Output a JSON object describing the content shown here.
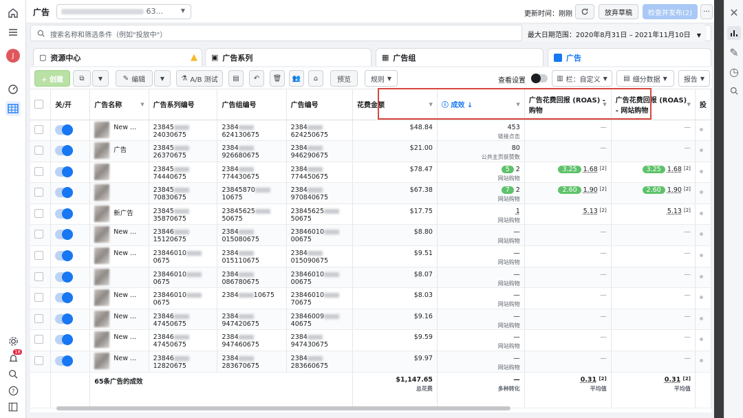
{
  "topbar": {
    "title": "广告",
    "account_fragment": "63...",
    "updated_label": "更新时间：刚刚",
    "discard_label": "放弃草稿",
    "publish_label": "检查并发布(2)",
    "more_label": "···"
  },
  "search": {
    "placeholder": "搜索名称和筛选条件（例如\"投放中\"）",
    "date_range": "最大日期范围：2020年8月31日 – 2021年11月10日"
  },
  "tabs": [
    {
      "label": "资源中心"
    },
    {
      "label": "广告系列"
    },
    {
      "label": "广告组"
    },
    {
      "label": "广告"
    }
  ],
  "toolbar": {
    "create": "+ 创建",
    "edit": "编辑",
    "ab_test": "A/B 测试",
    "preview": "预览",
    "rules": "规则",
    "view_settings": "查看设置",
    "columns": "栏：自定义",
    "breakdown": "细分数据",
    "reports": "报告"
  },
  "columns": {
    "onoff": "关/开",
    "name": "广告名称",
    "campaign_id": "广告系列编号",
    "adset_id": "广告组编号",
    "ad_id": "广告编号",
    "spend": "花费金额",
    "results": "成效",
    "roas": "广告花费回报 (ROAS) - 购物",
    "roas_web": "广告花费回报 (ROAS) - 网站购物",
    "bid": "投"
  },
  "rows": [
    {
      "name": "New ...",
      "campaign": "23845",
      "campaign_end": "24030675",
      "adset": "2384",
      "adset_end": "624130675",
      "ad": "2384",
      "ad_end": "624250675",
      "spend": "$48.84",
      "result": "453",
      "result_label": "链接点击",
      "pill": "",
      "roas": "—",
      "roas_web": "—"
    },
    {
      "name": "广告",
      "campaign": "23845",
      "campaign_end": "26370675",
      "adset": "2384",
      "adset_end": "926680675",
      "ad": "2384",
      "ad_end": "946290675",
      "spend": "$21.00",
      "result": "80",
      "result_label": "公共主页获赞数",
      "pill": "",
      "roas": "—",
      "roas_web": "—"
    },
    {
      "name": "",
      "campaign": "23845",
      "campaign_end": "74440675",
      "adset": "2384",
      "adset_end": "774430675",
      "ad": "2384",
      "ad_end": "774450675",
      "spend": "$78.47",
      "result": "2",
      "result_label": "网站购物",
      "pill": "5",
      "roas_pill": "3.25",
      "roas": "1.68",
      "roas_web_pill": "3.25",
      "roas_web": "1.68"
    },
    {
      "name": "",
      "campaign": "23845",
      "campaign_end": "70830675",
      "adset": "23845870",
      "adset_end": "10675",
      "ad": "2384",
      "ad_end": "970840675",
      "spend": "$67.38",
      "result": "2",
      "result_label": "网站购物",
      "pill": "7",
      "roas_pill": "2.60",
      "roas": "1.90",
      "roas_web_pill": "2.60",
      "roas_web": "1.90"
    },
    {
      "name": "新广告",
      "campaign": "23845",
      "campaign_end": "35870675",
      "adset": "23845625",
      "adset_end": "50675",
      "ad": "23845625",
      "ad_end": "50675",
      "spend": "$17.75",
      "result": "1",
      "result_label": "网站购物",
      "pill": "",
      "roas": "5.13",
      "roas_web": "5.13"
    },
    {
      "name": "New ...",
      "campaign": "23846",
      "campaign_end": "15120675",
      "adset": "2384",
      "adset_end": "015080675",
      "ad": "23846010",
      "ad_end": "00675",
      "spend": "$8.80",
      "result": "—",
      "result_label": "网站购物",
      "pill": "",
      "roas": "—",
      "roas_web": "—"
    },
    {
      "name": "New ...",
      "campaign": "23846010",
      "campaign_end": "0675",
      "adset": "2384",
      "adset_end": "015110675",
      "ad": "2384",
      "ad_end": "015090675",
      "spend": "$9.51",
      "result": "—",
      "result_label": "网站购物",
      "pill": "",
      "roas": "—",
      "roas_web": "—"
    },
    {
      "name": "",
      "campaign": "23846010",
      "campaign_end": "0675",
      "adset": "2384",
      "adset_end": "086780675",
      "ad": "23846010",
      "ad_end": "00675",
      "spend": "$8.07",
      "result": "—",
      "result_label": "网站购物",
      "pill": "",
      "roas": "—",
      "roas_web": "—"
    },
    {
      "name": "New ...",
      "campaign": "23846010",
      "campaign_end": "0675",
      "adset": "2384",
      "adset_end": "10675",
      "ad": "23846010",
      "ad_end": "70675",
      "spend": "$8.03",
      "result": "—",
      "result_label": "网站购物",
      "pill": "",
      "roas": "—",
      "roas_web": "—"
    },
    {
      "name": "New ...",
      "campaign": "23846",
      "campaign_end": "47450675",
      "adset": "2384",
      "adset_end": "947420675",
      "ad": "23846009",
      "ad_end": "40675",
      "spend": "$9.16",
      "result": "—",
      "result_label": "网站购物",
      "pill": "",
      "roas": "—",
      "roas_web": "—"
    },
    {
      "name": "New ...",
      "campaign": "23846",
      "campaign_end": "47450675",
      "adset": "2384",
      "adset_end": "947460675",
      "ad": "2384",
      "ad_end": "947430675",
      "spend": "$9.59",
      "result": "—",
      "result_label": "网站购物",
      "pill": "",
      "roas": "—",
      "roas_web": "—"
    },
    {
      "name": "New ...",
      "campaign": "23846",
      "campaign_end": "12820675",
      "adset": "2384",
      "adset_end": "283670675",
      "ad": "2384",
      "ad_end": "283660675",
      "spend": "$9.97",
      "result": "—",
      "result_label": "网站购物",
      "pill": "",
      "roas": "—",
      "roas_web": "—"
    }
  ],
  "footer": {
    "label": "65条广告的成效",
    "spend": "$1,147.65",
    "spend_label": "总花费",
    "result": "—",
    "result_label": "多种转化",
    "roas": "0.31",
    "roas_label": "平均值",
    "roas_web": "0.31",
    "roas_web_label": "平均值",
    "sup": "[2]"
  },
  "sidebar": {
    "notifications_badge": "18",
    "avatar": "J"
  },
  "colors": {
    "accent": "#1877f2",
    "highlight_box": "#d9453b",
    "pill_green": "#5ec26a"
  }
}
